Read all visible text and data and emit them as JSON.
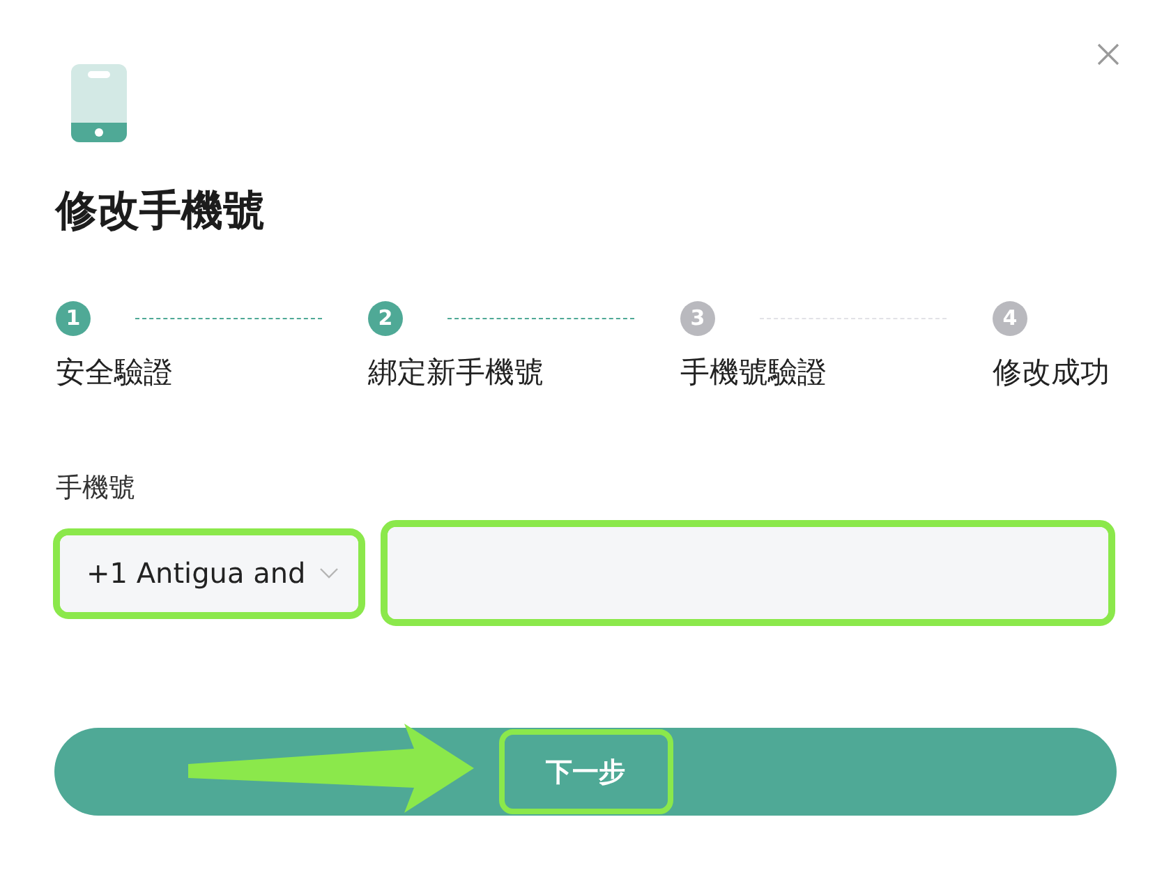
{
  "dialog": {
    "title": "修改手機號"
  },
  "steps": [
    {
      "number": "1",
      "label": "安全驗證",
      "active": true
    },
    {
      "number": "2",
      "label": "綁定新手機號",
      "active": true
    },
    {
      "number": "3",
      "label": "手機號驗證",
      "active": false
    },
    {
      "number": "4",
      "label": "修改成功",
      "active": false
    }
  ],
  "phone_field": {
    "label": "手機號",
    "country_code": {
      "value": "+1 Antigua and",
      "highlighted": true
    },
    "number_input": {
      "highlighted": true
    }
  },
  "next_button": {
    "label": "下一步",
    "highlighted": true,
    "pointer_arrow": true
  }
}
